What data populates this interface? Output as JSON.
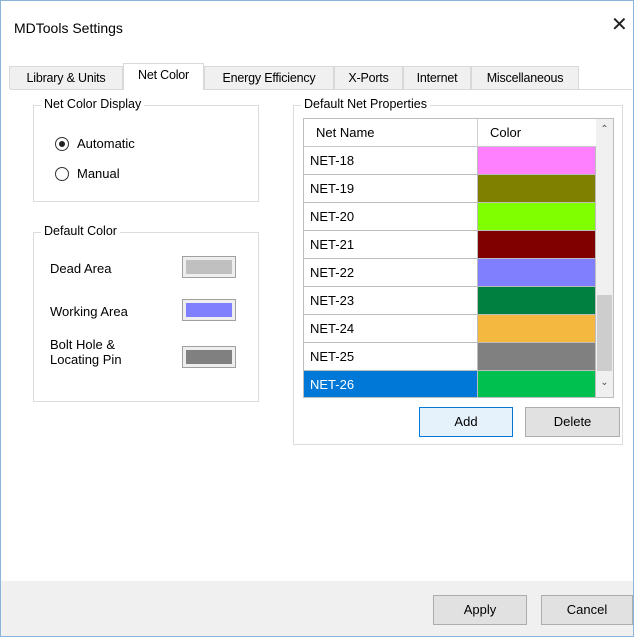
{
  "window": {
    "title": "MDTools Settings",
    "close_glyph": "✕"
  },
  "tabs": [
    {
      "label": "Library & Units",
      "active": false
    },
    {
      "label": "Net Color",
      "active": true
    },
    {
      "label": "Energy Efficiency",
      "active": false
    },
    {
      "label": "X-Ports",
      "active": false
    },
    {
      "label": "Internet",
      "active": false
    },
    {
      "label": "Miscellaneous",
      "active": false
    }
  ],
  "net_color_display": {
    "legend": "Net Color Display",
    "options": [
      {
        "label": "Automatic",
        "checked": true
      },
      {
        "label": "Manual",
        "checked": false
      }
    ]
  },
  "default_color": {
    "legend": "Default Color",
    "items": [
      {
        "label": "Dead Area",
        "color": "#c0c0c0"
      },
      {
        "label": "Working Area",
        "color": "#8080ff"
      },
      {
        "label": "Bolt Hole &\nLocating Pin",
        "color": "#808080"
      }
    ]
  },
  "net_properties": {
    "legend": "Default Net Properties",
    "columns": [
      "Net Name",
      "Color"
    ],
    "rows": [
      {
        "name": "NET-18",
        "color": "#ff80ff"
      },
      {
        "name": "NET-19",
        "color": "#808000"
      },
      {
        "name": "NET-20",
        "color": "#80ff00"
      },
      {
        "name": "NET-21",
        "color": "#800000"
      },
      {
        "name": "NET-22",
        "color": "#8080ff"
      },
      {
        "name": "NET-23",
        "color": "#008040"
      },
      {
        "name": "NET-24",
        "color": "#f4b840"
      },
      {
        "name": "NET-25",
        "color": "#808080"
      },
      {
        "name": "NET-26",
        "color": "#00c050",
        "selected": true
      }
    ],
    "add_label": "Add",
    "delete_label": "Delete"
  },
  "footer": {
    "apply_label": "Apply",
    "cancel_label": "Cancel"
  },
  "icons": {
    "scroll_up": "chevron-up-icon",
    "scroll_down": "chevron-down-icon"
  }
}
